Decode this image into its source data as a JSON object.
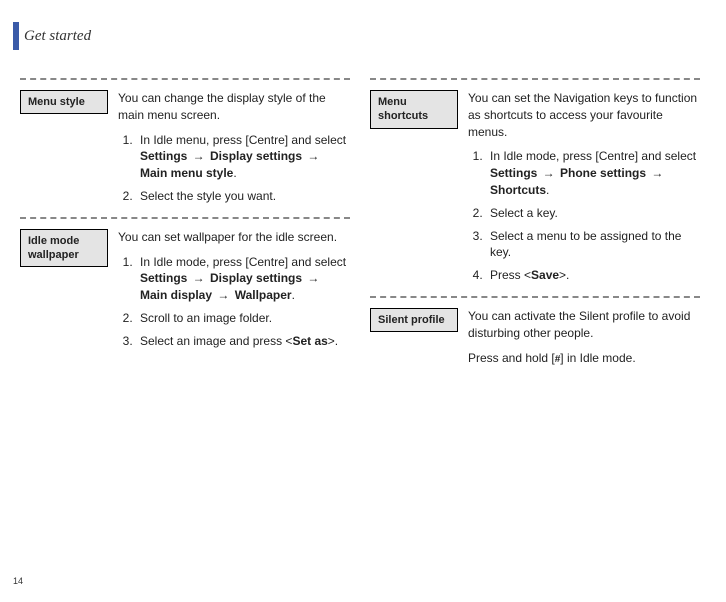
{
  "header": {
    "title": "Get started"
  },
  "footer": {
    "page_number": "14"
  },
  "glyphs": {
    "arrow": "→",
    "hash": "#"
  },
  "left_column": [
    {
      "label": "Menu style",
      "intro": "You can change the display style of the main menu screen.",
      "steps": [
        {
          "prefix": "In Idle menu, press [Centre] and select ",
          "bold_path": [
            "Settings",
            "Display settings",
            "Main menu style"
          ],
          "suffix": "."
        },
        {
          "plain": "Select the style you want."
        }
      ]
    },
    {
      "label": "Idle mode wallpaper",
      "intro": "You can set wallpaper for the idle screen.",
      "steps": [
        {
          "prefix": "In Idle mode, press [Centre] and select ",
          "bold_path": [
            "Settings",
            "Display settings",
            "Main display",
            "Wallpaper"
          ],
          "suffix": "."
        },
        {
          "plain": "Scroll to an image folder."
        },
        {
          "prefix": "Select an image and press <",
          "bold": "Set as",
          "suffix": ">."
        }
      ]
    }
  ],
  "right_column": [
    {
      "label": "Menu shortcuts",
      "intro": "You can set the Navigation keys to function as shortcuts to access your favourite menus.",
      "steps": [
        {
          "prefix": "In Idle mode, press [Centre] and select ",
          "bold_path": [
            "Settings",
            "Phone settings",
            "Shortcuts"
          ],
          "suffix": "."
        },
        {
          "plain": "Select a key."
        },
        {
          "plain": "Select a menu to be assigned to the key."
        },
        {
          "prefix": "Press <",
          "bold": "Save",
          "suffix": ">."
        }
      ]
    },
    {
      "label": "Silent profile",
      "intro": "You can activate the Silent profile to avoid disturbing other people.",
      "extra": {
        "prefix": "Press and hold [",
        "icon": "hash",
        "suffix": "] in Idle mode."
      }
    }
  ]
}
